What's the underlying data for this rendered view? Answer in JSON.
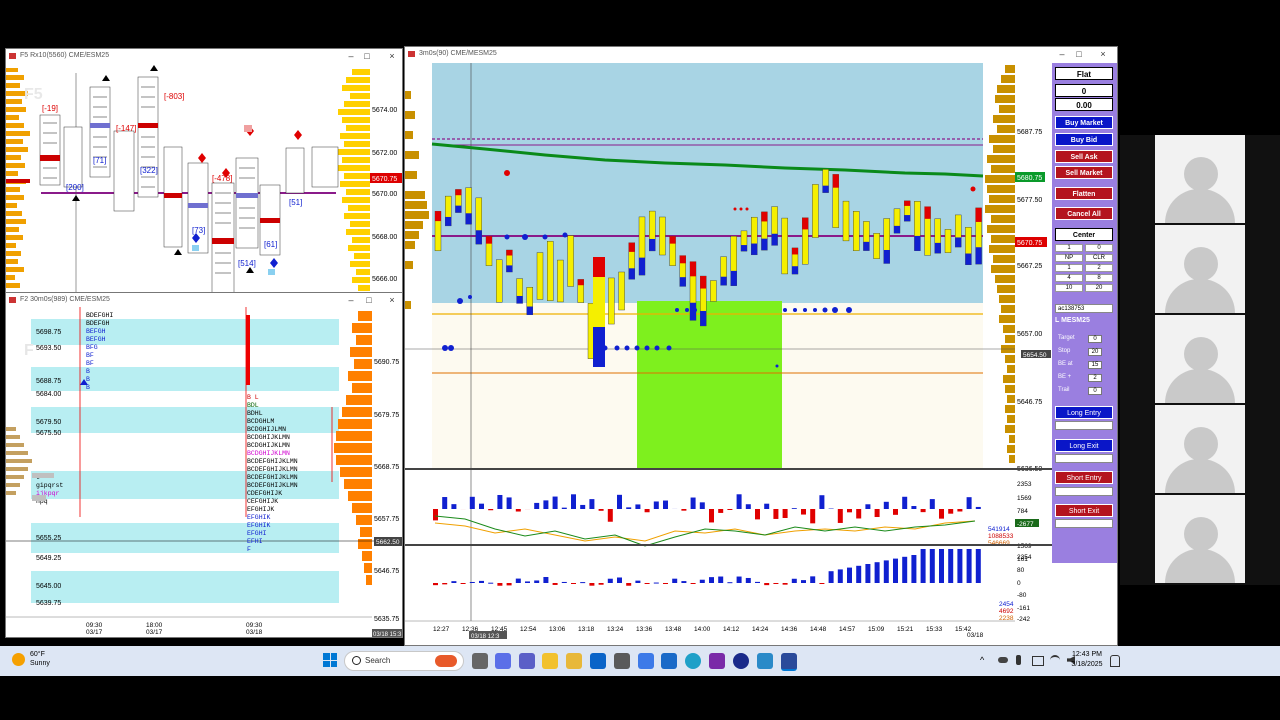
{
  "windows": {
    "top_left": {
      "title": "F5 Rx10(5560) CME/ESM25",
      "prices": [
        "5674.00",
        "5672.00",
        "5670.00",
        "5668.00",
        "5666.00"
      ],
      "current_price": "5670.75",
      "watermark": "F5",
      "labels": [
        "[-19]",
        "[71]",
        "[-147]",
        "[200]",
        "[322]",
        "[-803]",
        "[73]",
        "[-478]",
        "[514]",
        "[61]",
        "[51]"
      ]
    },
    "bottom_left": {
      "title": "F2 30m0s(989) CME/ESM25",
      "levels": [
        "5698.75",
        "5693.50",
        "5688.75",
        "5684.00",
        "5679.50",
        "5675.50",
        "5655.25",
        "5649.25",
        "5645.00",
        "5639.75"
      ],
      "prices": [
        "5690.75",
        "5679.75",
        "5668.75",
        "5657.75",
        "5646.75",
        "5635.75"
      ],
      "current_price": "5662.50",
      "time_labels": [
        {
          "t": "09:30",
          "d": "03/17"
        },
        {
          "t": "18:00",
          "d": "03/17"
        },
        {
          "t": "09:30",
          "d": "03/18"
        }
      ],
      "time_tag": "03/18 15:3",
      "watermark": "F"
    },
    "main": {
      "title": "3m0s(90) CME/MESM25",
      "prices": [
        "5687.75",
        "5677.50",
        "5667.25",
        "5657.00",
        "5646.75",
        "5636.50"
      ],
      "tag_green": "5680.75",
      "tag_red": "5670.75",
      "tag_gray": "5654.50",
      "times": [
        "12:27",
        "12:36",
        "12:45",
        "12:54",
        "13:06",
        "13:18",
        "13:24",
        "13:36",
        "13:48",
        "14:00",
        "14:12",
        "14:24",
        "14:36",
        "14:48",
        "14:57",
        "15:09",
        "15:21",
        "15:33",
        "15:42"
      ],
      "date_tag": "03/18",
      "cursor_tag": "03/18 12:3",
      "ind1_scale": [
        "2353",
        "1569",
        "784",
        "1569",
        "2354"
      ],
      "ind1_tag": "-2677",
      "ind1_values": [
        "541914",
        "1088533",
        "546669"
      ],
      "ind2_scale": [
        "161",
        "80",
        "0",
        "-80",
        "-161",
        "-242"
      ],
      "ind2_values": [
        "2454",
        "4692",
        "2238"
      ]
    }
  },
  "order_panel": {
    "position": "Flat",
    "qty": "0",
    "pnl": "0.00",
    "buy_market": "Buy Market",
    "buy_bid": "Buy Bid",
    "sell_ask": "Sell Ask",
    "sell_market": "Sell Market",
    "flatten": "Flatten",
    "cancel_all": "Cancel All",
    "center": "Center",
    "qty_grid": [
      [
        "1",
        "0"
      ],
      [
        "NP",
        "CLR"
      ],
      [
        "1",
        "2"
      ],
      [
        "4",
        "8"
      ],
      [
        "10",
        "20"
      ]
    ],
    "account": "ac138753",
    "symbol": "L MESM25",
    "fields": [
      {
        "label": "Target",
        "value": "0"
      },
      {
        "label": "Stop",
        "value": "20"
      },
      {
        "label": "BE at",
        "value": "15"
      },
      {
        "label": "BE +",
        "value": "2"
      },
      {
        "label": "Trail",
        "value": "0"
      }
    ],
    "long_entry": "Long Entry",
    "long_exit": "Long Exit",
    "short_entry": "Short Entry",
    "short_exit": "Short Exit",
    "colors": {
      "buy": "#0a16c8",
      "sell": "#b4141e",
      "panel": "#9a7fe0"
    }
  },
  "taskbar": {
    "temp": "60°F",
    "weather": "Sunny",
    "search": "Search",
    "time": "12:43 PM",
    "date": "3/18/2025",
    "icons": [
      "windows-start",
      "search",
      "widgets",
      "task-view",
      "copilot",
      "teams",
      "explorer",
      "store",
      "outlook",
      "settings",
      "edge-copilot",
      "mail",
      "edge",
      "visual-studio",
      "app-blue",
      "app-cyan",
      "app-active"
    ]
  }
}
